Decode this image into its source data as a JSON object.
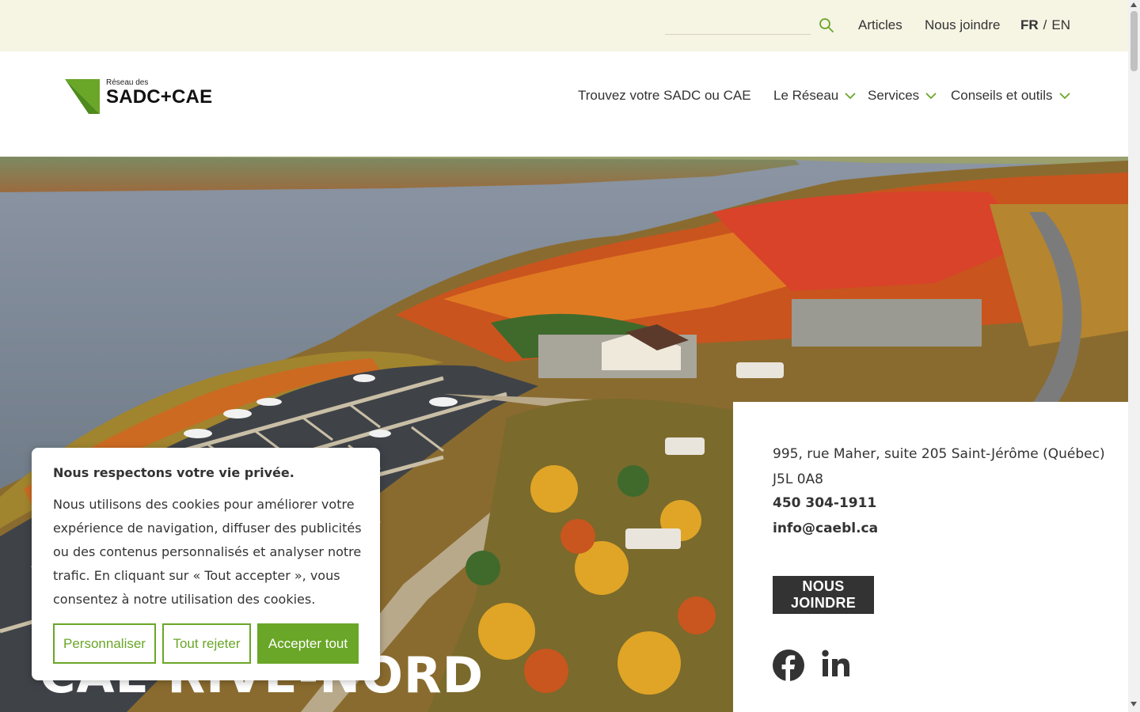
{
  "topbar": {
    "search_placeholder": "",
    "links": [
      "Articles",
      "Nous joindre"
    ],
    "lang_fr": "FR",
    "lang_sep": "/",
    "lang_en": "EN"
  },
  "header": {
    "logo_small": "Réseau des",
    "logo_big": "SADC+CAE",
    "nav": [
      {
        "label": "Trouvez votre SADC ou CAE"
      },
      {
        "label": "Le Réseau"
      },
      {
        "label": "Services"
      },
      {
        "label": "Conseils et outils"
      }
    ]
  },
  "hero": {
    "title": "CAE RIVE-NORD"
  },
  "contact": {
    "address": "995, rue Maher, suite 205 Saint-Jérôme (Québec) J5L 0A8",
    "phone": "450 304-1911",
    "email": "info@caebl.ca",
    "join_label": "NOUS JOINDRE",
    "social": [
      "facebook-icon",
      "linkedin-icon"
    ]
  },
  "cookie": {
    "title": "Nous respectons votre vie privée.",
    "text": "Nous utilisons des cookies pour améliorer votre expérience de navigation, diffuser des publicités ou des contenus personnalisés et analyser notre trafic. En cliquant sur « Tout accepter », vous consentez à notre utilisation des cookies.",
    "btn_customize": "Personnaliser",
    "btn_reject": "Tout rejeter",
    "btn_accept": "Accepter tout"
  },
  "colors": {
    "accent_green": "#6aa628",
    "topbar_bg": "#f6f4e3",
    "dark_button": "#333333"
  }
}
